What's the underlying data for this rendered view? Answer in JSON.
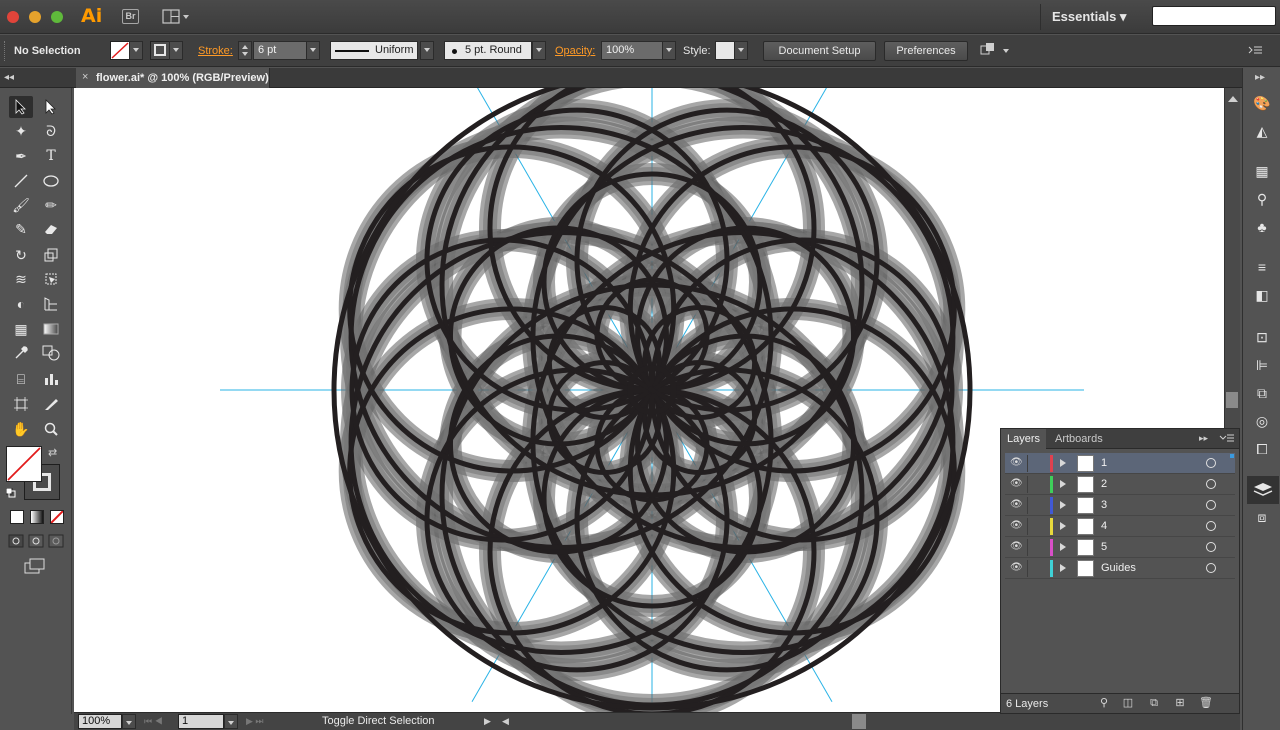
{
  "app": {
    "logo": "Ai",
    "bridge": "Br",
    "workspace": "Essentials ▾",
    "search_value": ""
  },
  "colors": {
    "accent_orange": "#ff9a00",
    "guide_cyan": "#2ab3e6",
    "flower_dark": "#231f20",
    "flower_gray": "#6b6b6b"
  },
  "control": {
    "selection": "No Selection",
    "stroke_label": "Stroke:",
    "stroke_value": "6 pt",
    "profile": "Uniform",
    "brush": "5 pt. Round",
    "opacity_label": "Opacity:",
    "opacity_value": "100%",
    "style_label": "Style:",
    "document_setup": "Document Setup",
    "preferences": "Preferences"
  },
  "document": {
    "tab_close": "×",
    "tab_title": "flower.ai* @ 100% (RGB/Preview)"
  },
  "status": {
    "zoom": "100%",
    "artboard": "1",
    "message": "Toggle Direct Selection"
  },
  "layers_panel": {
    "tab_layers": "Layers",
    "tab_artboards": "Artboards",
    "count": "6 Layers",
    "layers": [
      {
        "name": "1",
        "color": "#e0414f",
        "selected": true
      },
      {
        "name": "2",
        "color": "#3ecf5a",
        "selected": false
      },
      {
        "name": "3",
        "color": "#4159d6",
        "selected": false
      },
      {
        "name": "4",
        "color": "#e8d93c",
        "selected": false
      },
      {
        "name": "5",
        "color": "#d94fc8",
        "selected": false
      },
      {
        "name": "Guides",
        "color": "#3fd1d6",
        "selected": false
      }
    ]
  },
  "tools": [
    "selection-tool",
    "direct-selection-tool",
    "magic-wand-tool",
    "lasso-tool",
    "pen-tool",
    "type-tool",
    "line-tool",
    "ellipse-tool",
    "paintbrush-tool",
    "pencil-tool",
    "blob-brush-tool",
    "eraser-tool",
    "rotate-tool",
    "scale-tool",
    "warp-tool",
    "free-transform-tool",
    "shape-builder-tool",
    "perspective-grid-tool",
    "mesh-tool",
    "gradient-tool",
    "eyedropper-tool",
    "blend-tool",
    "symbol-sprayer-tool",
    "column-graph-tool",
    "artboard-tool",
    "slice-tool",
    "hand-tool",
    "zoom-tool"
  ]
}
